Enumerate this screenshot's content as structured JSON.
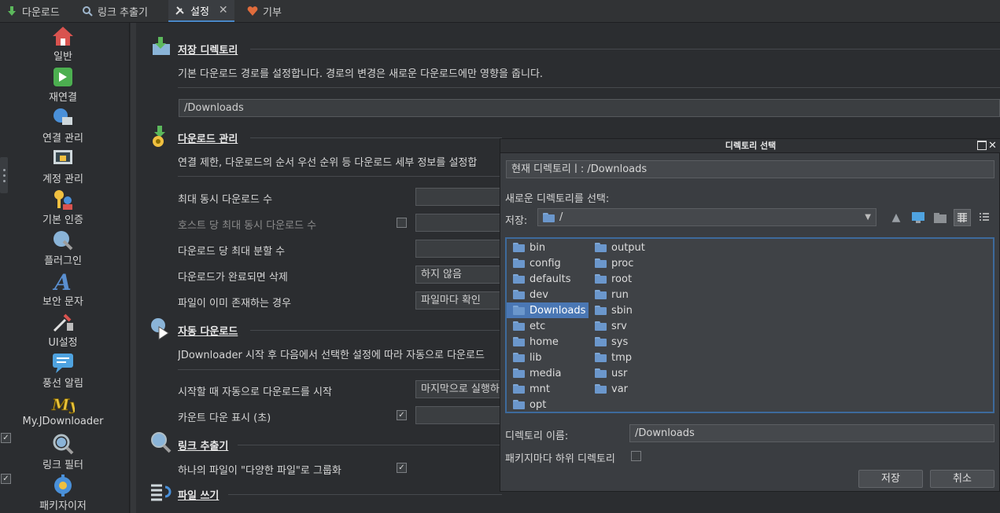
{
  "tabs": [
    {
      "label": "다운로드",
      "icon": "download-arrow-icon"
    },
    {
      "label": "링크 추출기",
      "icon": "magnifier-icon"
    },
    {
      "label": "설정",
      "icon": "tools-icon"
    },
    {
      "label": "기부",
      "icon": "heart-icon"
    }
  ],
  "sidebar": {
    "items": [
      {
        "label": "일반",
        "icon": "home-icon"
      },
      {
        "label": "재연결",
        "icon": "reconnect-icon"
      },
      {
        "label": "연결 관리",
        "icon": "connection-icon"
      },
      {
        "label": "계정 관리",
        "icon": "account-lock-icon"
      },
      {
        "label": "기본 인증",
        "icon": "key-user-icon"
      },
      {
        "label": "플러그인",
        "icon": "plugin-icon"
      },
      {
        "label": "보안 문자",
        "icon": "captcha-icon"
      },
      {
        "label": "UI설정",
        "icon": "ui-settings-icon"
      },
      {
        "label": "풍선 알림",
        "icon": "balloon-icon"
      },
      {
        "label": "My.JDownloader",
        "icon": "myjd-icon"
      },
      {
        "label": "링크 필터",
        "icon": "link-filter-icon"
      },
      {
        "label": "패키자이저",
        "icon": "packagizer-icon"
      }
    ]
  },
  "settings": {
    "save_dir": {
      "title": "저장 디렉토리",
      "desc": "기본 다운로드 경로를 설정합니다. 경로의 변경은 새로운 다운로드에만 영향을 줍니다.",
      "path": "/Downloads"
    },
    "download_mgmt": {
      "title": "다운로드 관리",
      "desc": "연결 제한, 다운로드의 순서 우선 순위 등 다운로드 세부 정보를 설정합",
      "rows": [
        {
          "label": "최대 동시 다운로드 수",
          "value": ""
        },
        {
          "label": "호스트 당 최대 동시 다운로드 수",
          "value": ""
        },
        {
          "label": "다운로드 당 최대 분할 수",
          "value": ""
        },
        {
          "label": "다운로드가 완료되면 삭제",
          "value": "하지 않음"
        },
        {
          "label": "파일이 이미 존재하는 경우",
          "value": "파일마다 확인"
        }
      ]
    },
    "auto_download": {
      "title": "자동 다운로드",
      "desc": "JDownloader 시작 후 다음에서 선택한 설정에 따라 자동으로 다운로드",
      "rows": [
        {
          "label": "시작할 때 자동으로 다운로드를 시작",
          "value": "마지막으로 실행하"
        },
        {
          "label": "카운트 다운 표시 (초)",
          "value": ""
        }
      ]
    },
    "link_grabber": {
      "title": "링크 추출기",
      "rows": [
        {
          "label": "하나의 파일이 \"다양한 파일\"로 그룹화"
        }
      ]
    },
    "file_write": {
      "title": "파일 쓰기"
    }
  },
  "dialog": {
    "title": "디렉토리 선택",
    "current_dir": "현재 디렉토리ㅣ: /Downloads",
    "choose_label": "새로운 디렉토리를 선택:",
    "lookin_label": "저장:",
    "lookin_value": "/",
    "folders_col1": [
      "bin",
      "config",
      "defaults",
      "dev",
      "Downloads",
      "etc",
      "home",
      "lib",
      "media",
      "mnt",
      "opt"
    ],
    "folders_col2": [
      "output",
      "proc",
      "root",
      "run",
      "sbin",
      "srv",
      "sys",
      "tmp",
      "usr",
      "var"
    ],
    "selected_folder": "Downloads",
    "dirname_label": "디렉토리 이름:",
    "dirname_value": "/Downloads",
    "subdir_label": "패키지마다 하위 디렉토리",
    "save_button": "저장",
    "cancel_button": "취소"
  },
  "colors": {
    "accent": "#4a88c7",
    "selection": "#4a77b4",
    "background": "#2b2d30"
  }
}
